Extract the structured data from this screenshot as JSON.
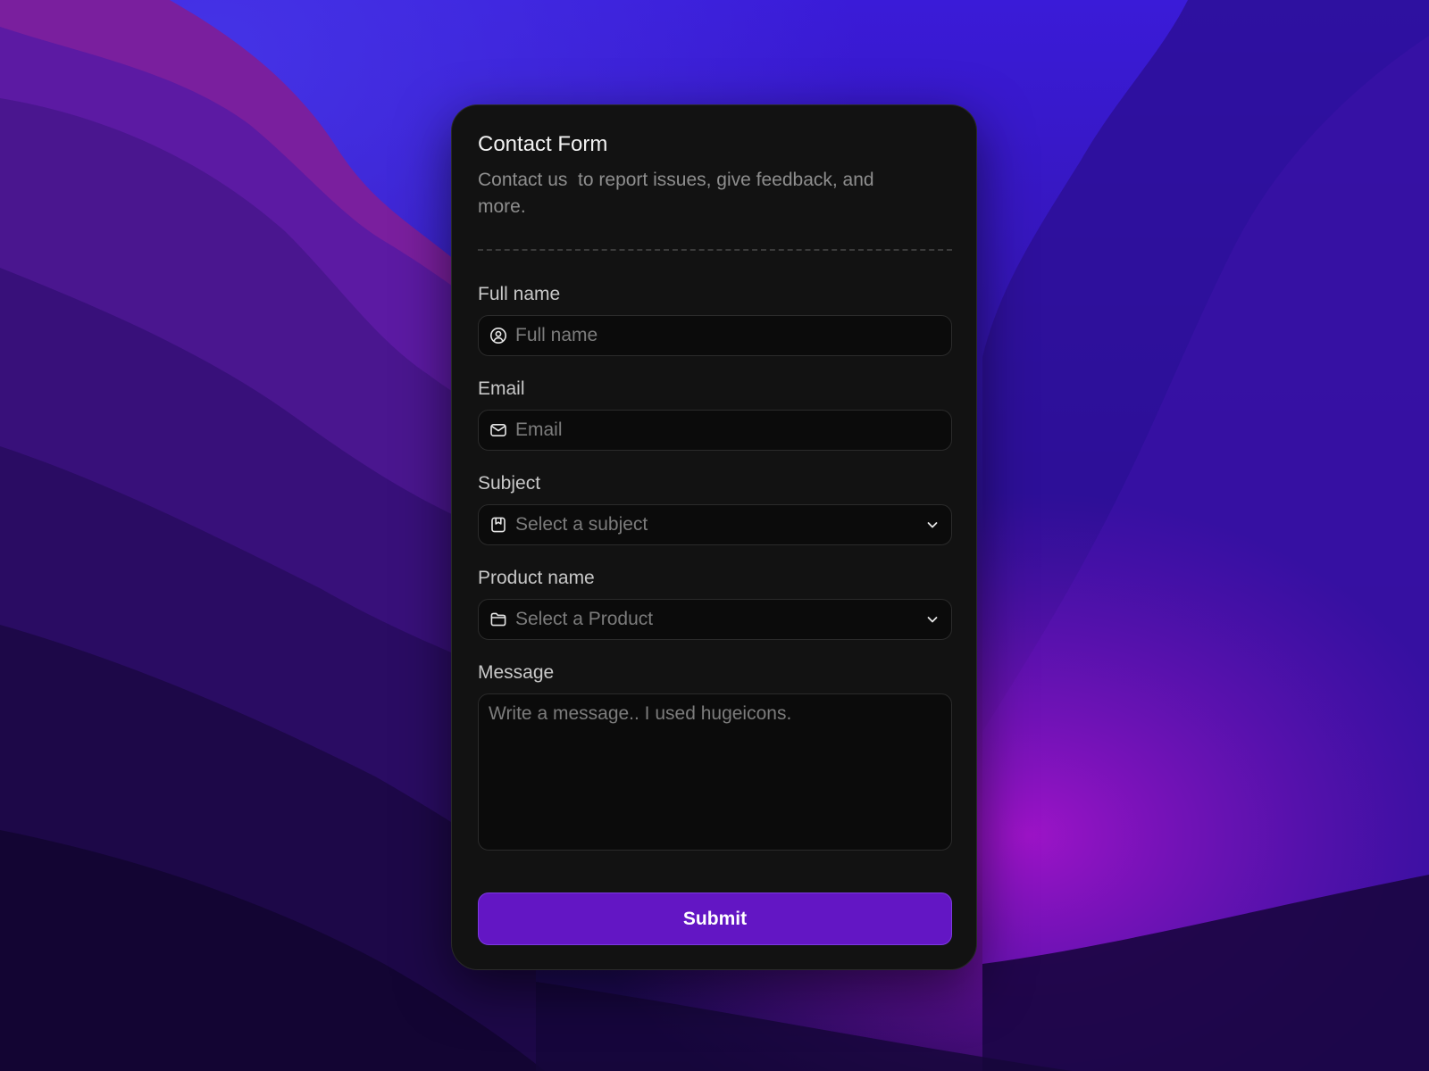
{
  "form": {
    "title": "Contact Form",
    "description": "Contact us  to report issues, give feedback, and more.",
    "full_name": {
      "label": "Full name",
      "placeholder": "Full name",
      "icon": "user-circle-icon"
    },
    "email": {
      "label": "Email",
      "placeholder": "Email",
      "icon": "mail-icon"
    },
    "subject": {
      "label": "Subject",
      "placeholder": "Select a subject",
      "icon": "bookmark-icon",
      "dropdown_icon": "chevron-down-icon"
    },
    "product": {
      "label": "Product name",
      "placeholder": "Select a Product",
      "icon": "folder-icon",
      "dropdown_icon": "chevron-down-icon"
    },
    "message": {
      "label": "Message",
      "placeholder": "Write a message.. I used hugeicons."
    },
    "submit_label": "Submit"
  },
  "colors": {
    "card_background": "#121212",
    "input_background": "#0b0b0b",
    "accent": "#6316c4",
    "title_text": "#f2f2f2",
    "muted_text": "#8e8e8e",
    "placeholder_text": "#7c7c7c"
  }
}
